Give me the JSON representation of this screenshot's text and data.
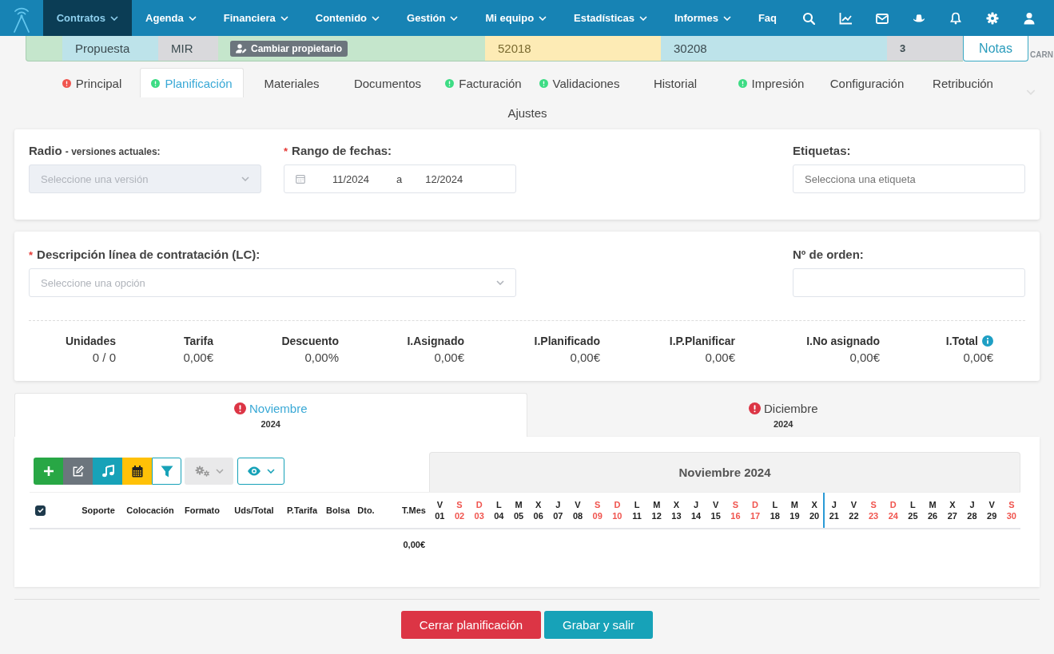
{
  "nav": {
    "items": [
      {
        "label": "Contratos",
        "dropdown": true,
        "selected": true
      },
      {
        "label": "Agenda",
        "dropdown": true,
        "selected": false
      },
      {
        "label": "Financiera",
        "dropdown": true,
        "selected": false
      },
      {
        "label": "Contenido",
        "dropdown": true,
        "selected": false
      },
      {
        "label": "Gestión",
        "dropdown": true,
        "selected": false
      },
      {
        "label": "Mi equipo",
        "dropdown": true,
        "selected": false
      },
      {
        "label": "Estadísticas",
        "dropdown": true,
        "selected": false
      },
      {
        "label": "Informes",
        "dropdown": true,
        "selected": false
      },
      {
        "label": "Faq",
        "dropdown": false,
        "selected": false
      }
    ]
  },
  "contract_bar": {
    "status": "Propuesta",
    "code": "MIR",
    "owner_button": "Cambiar propietario",
    "field_1": "52018",
    "field_2": "30208",
    "count": "3",
    "notes_button": "Notas",
    "edge_text": "CARN"
  },
  "tabs": [
    {
      "label": "Principal",
      "selected": false,
      "color": "#f0554f"
    },
    {
      "label": "Planificación",
      "selected": true,
      "color": "#3ddc84"
    },
    {
      "label": "Materiales",
      "selected": false
    },
    {
      "label": "Documentos",
      "selected": false
    },
    {
      "label": "Facturación",
      "selected": false,
      "color": "#3ddc84"
    },
    {
      "label": "Validaciones",
      "selected": false,
      "color": "#3ddc84"
    },
    {
      "label": "Historial",
      "selected": false
    },
    {
      "label": "Impresión",
      "selected": false,
      "color": "#3ddc84"
    },
    {
      "label": "Configuración",
      "selected": false
    },
    {
      "label": "Retribución",
      "selected": false
    },
    {
      "label": "Ajustes",
      "selected": false
    }
  ],
  "filters": {
    "radio": {
      "label": "Radio",
      "hint": "- versiones actuales:",
      "placeholder": "Seleccione una versión",
      "disabled": true
    },
    "date_range": {
      "required_mark": "*",
      "label": "Rango de fechas:",
      "from": "11/2024",
      "separator": "a",
      "to": "12/2024"
    },
    "tags": {
      "label": "Etiquetas:",
      "placeholder": "Selecciona una etiqueta"
    }
  },
  "line": {
    "description": {
      "required_mark": "*",
      "label": "Descripción línea de contratación (LC):",
      "placeholder": "Seleccione una opción"
    },
    "order": {
      "label": "Nº de orden:"
    },
    "summary": [
      {
        "label": "Unidades",
        "value": "0 / 0",
        "info": false
      },
      {
        "label": "Tarifa",
        "value": "0,00€",
        "info": false
      },
      {
        "label": "Descuento",
        "value": "0,00%",
        "info": false
      },
      {
        "label": "I.Asignado",
        "value": "0,00€",
        "info": false
      },
      {
        "label": "I.Planificado",
        "value": "0,00€",
        "info": false
      },
      {
        "label": "I.P.Planificar",
        "value": "0,00€",
        "info": false
      },
      {
        "label": "I.No asignado",
        "value": "0,00€",
        "info": false
      },
      {
        "label": "I.Total",
        "value": "0,00€",
        "info": true
      }
    ]
  },
  "month_tabs": [
    {
      "month": "Noviembre",
      "year": "2024",
      "selected": true,
      "alert": true
    },
    {
      "month": "Diciembre",
      "year": "2024",
      "selected": false,
      "alert": true
    }
  ],
  "planning": {
    "calendar_title": "Noviembre 2024",
    "select_all_checked": true,
    "columns": [
      "Soporte",
      "Colocación",
      "Formato",
      "Uds/Total",
      "P.Tarifa",
      "Bolsa",
      "Dto.",
      "T.Mes"
    ],
    "days": [
      {
        "weekday": "V",
        "day": "01",
        "weekend": false,
        "today": false
      },
      {
        "weekday": "S",
        "day": "02",
        "weekend": true,
        "today": false
      },
      {
        "weekday": "D",
        "day": "03",
        "weekend": true,
        "today": false
      },
      {
        "weekday": "L",
        "day": "04",
        "weekend": false,
        "today": false
      },
      {
        "weekday": "M",
        "day": "05",
        "weekend": false,
        "today": false
      },
      {
        "weekday": "X",
        "day": "06",
        "weekend": false,
        "today": false
      },
      {
        "weekday": "J",
        "day": "07",
        "weekend": false,
        "today": false
      },
      {
        "weekday": "V",
        "day": "08",
        "weekend": false,
        "today": false
      },
      {
        "weekday": "S",
        "day": "09",
        "weekend": true,
        "today": false
      },
      {
        "weekday": "D",
        "day": "10",
        "weekend": true,
        "today": false
      },
      {
        "weekday": "L",
        "day": "11",
        "weekend": false,
        "today": false
      },
      {
        "weekday": "M",
        "day": "12",
        "weekend": false,
        "today": false
      },
      {
        "weekday": "X",
        "day": "13",
        "weekend": false,
        "today": false
      },
      {
        "weekday": "J",
        "day": "14",
        "weekend": false,
        "today": false
      },
      {
        "weekday": "V",
        "day": "15",
        "weekend": false,
        "today": false
      },
      {
        "weekday": "S",
        "day": "16",
        "weekend": true,
        "today": false
      },
      {
        "weekday": "D",
        "day": "17",
        "weekend": true,
        "today": false
      },
      {
        "weekday": "L",
        "day": "18",
        "weekend": false,
        "today": false
      },
      {
        "weekday": "M",
        "day": "19",
        "weekend": false,
        "today": false
      },
      {
        "weekday": "X",
        "day": "20",
        "weekend": false,
        "today": false
      },
      {
        "weekday": "J",
        "day": "21",
        "weekend": false,
        "today": true
      },
      {
        "weekday": "V",
        "day": "22",
        "weekend": false,
        "today": false
      },
      {
        "weekday": "S",
        "day": "23",
        "weekend": true,
        "today": false
      },
      {
        "weekday": "D",
        "day": "24",
        "weekend": true,
        "today": false
      },
      {
        "weekday": "L",
        "day": "25",
        "weekend": false,
        "today": false
      },
      {
        "weekday": "M",
        "day": "26",
        "weekend": false,
        "today": false
      },
      {
        "weekday": "X",
        "day": "27",
        "weekend": false,
        "today": false
      },
      {
        "weekday": "J",
        "day": "28",
        "weekend": false,
        "today": false
      },
      {
        "weekday": "V",
        "day": "29",
        "weekend": false,
        "today": false
      },
      {
        "weekday": "S",
        "day": "30",
        "weekend": true,
        "today": false
      }
    ],
    "total": "0,00€"
  },
  "actions": [
    {
      "label": "Cerrar planificación",
      "kind": "danger"
    },
    {
      "label": "Grabar y salir",
      "kind": "primary"
    }
  ]
}
